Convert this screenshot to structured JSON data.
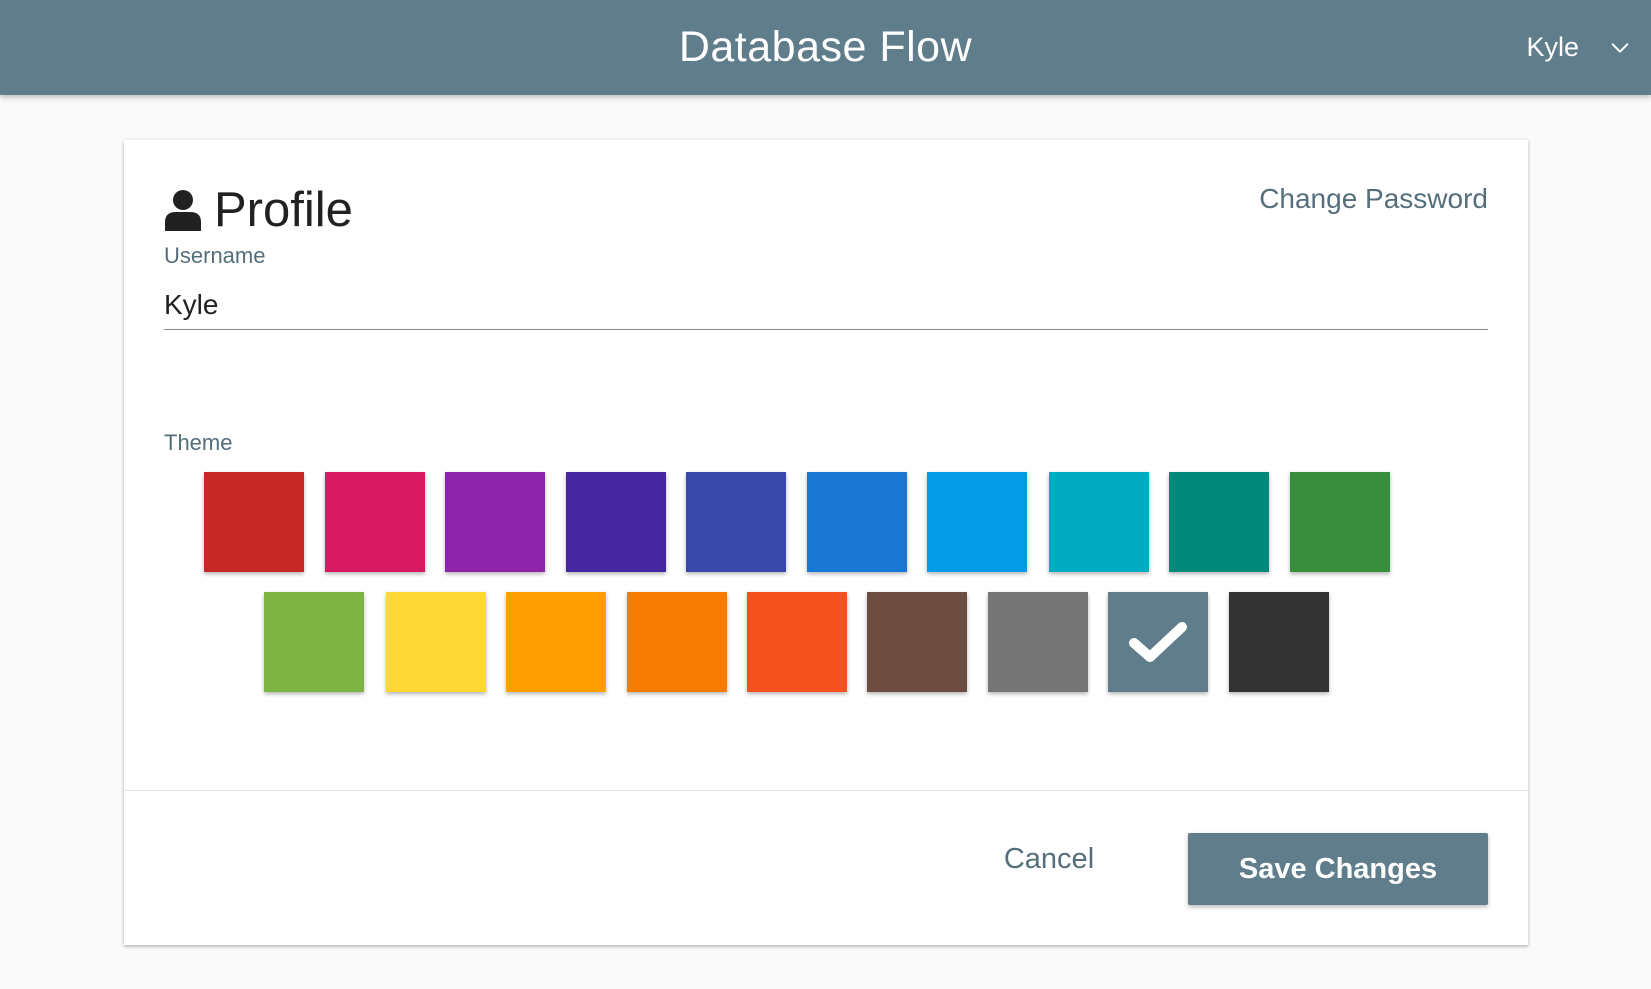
{
  "colors": {
    "accent": "#607d8b"
  },
  "header": {
    "title": "Database Flow",
    "user_name": "Kyle",
    "menu_icon": "chevron-down-icon"
  },
  "profile": {
    "title": "Profile",
    "title_icon": "person-icon",
    "change_password_label": "Change Password",
    "username_label": "Username",
    "username_value": "Kyle",
    "theme_label": "Theme",
    "themes": [
      {
        "name": "red",
        "color": "#c62828"
      },
      {
        "name": "pink",
        "color": "#d81b60"
      },
      {
        "name": "purple",
        "color": "#8e24aa"
      },
      {
        "name": "deep-purple",
        "color": "#4527a0"
      },
      {
        "name": "indigo",
        "color": "#3949ab"
      },
      {
        "name": "blue",
        "color": "#1976d2"
      },
      {
        "name": "light-blue",
        "color": "#039be5"
      },
      {
        "name": "cyan",
        "color": "#00acc1"
      },
      {
        "name": "teal",
        "color": "#00897b"
      },
      {
        "name": "green",
        "color": "#388e3c"
      },
      {
        "name": "light-green",
        "color": "#7cb342"
      },
      {
        "name": "yellow",
        "color": "#fdd835"
      },
      {
        "name": "amber",
        "color": "#ffa000"
      },
      {
        "name": "orange",
        "color": "#f57c00"
      },
      {
        "name": "deep-orange",
        "color": "#f4511e"
      },
      {
        "name": "brown",
        "color": "#6d4c41"
      },
      {
        "name": "grey",
        "color": "#757575"
      },
      {
        "name": "blue-grey",
        "color": "#607d8b",
        "selected": true
      },
      {
        "name": "black",
        "color": "#333333"
      }
    ],
    "cancel_label": "Cancel",
    "save_label": "Save Changes"
  }
}
